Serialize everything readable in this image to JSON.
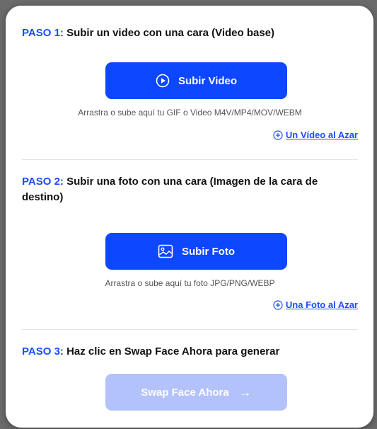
{
  "colors": {
    "accent": "#0d47ff",
    "step_number": "#1a4dff",
    "disabled_button": "#b3c2fb"
  },
  "step1": {
    "number": "PASO 1:",
    "text": " Subir un video con una cara (Video base)",
    "button_label": "Subir Video",
    "button_icon": "play-circle-icon",
    "hint": "Arrastra o sube aquí tu GIF o Video M4V/MP4/MOV/WEBM",
    "random_link": "Un Vídeo al Azar",
    "random_icon": "plus-circle-icon"
  },
  "step2": {
    "number": "PASO 2:",
    "text": " Subir una foto con una cara (Imagen de la cara de destino)",
    "button_label": "Subir Foto",
    "button_icon": "image-icon",
    "hint": "Arrastra o sube aquí tu foto JPG/PNG/WEBP",
    "random_link": "Una Foto al Azar",
    "random_icon": "plus-circle-icon"
  },
  "step3": {
    "number": "PASO 3:",
    "text": " Haz clic en Swap Face Ahora para generar",
    "button_label": "Swap Face Ahora",
    "button_arrow": "→"
  }
}
